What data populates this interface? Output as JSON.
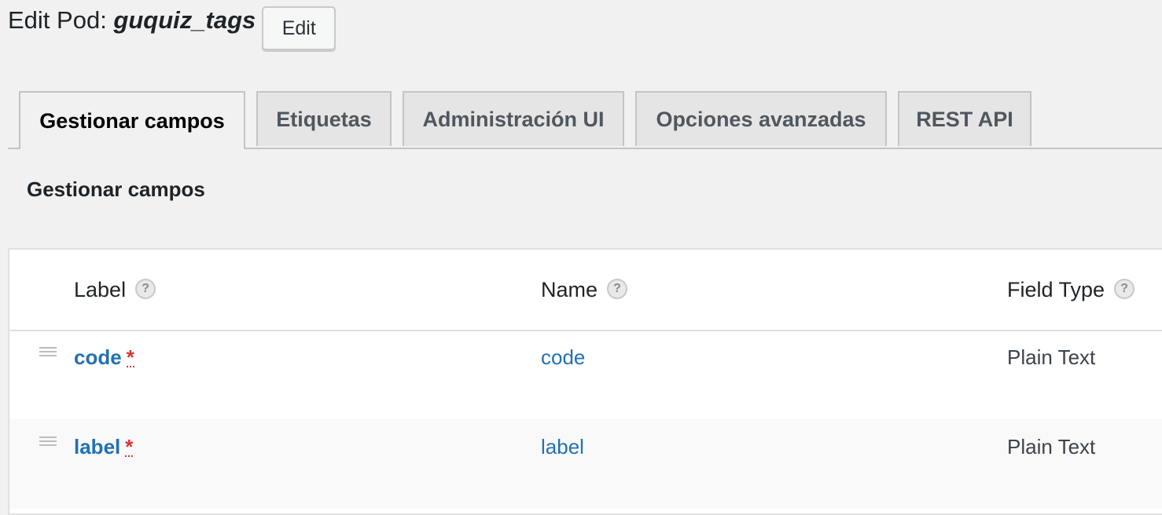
{
  "header": {
    "title_prefix": "Edit Pod: ",
    "pod_name": "guquiz_tags",
    "edit_label": "Edit"
  },
  "tabs": [
    {
      "label": "Gestionar campos",
      "active": true
    },
    {
      "label": "Etiquetas",
      "active": false
    },
    {
      "label": "Administración UI",
      "active": false
    },
    {
      "label": "Opciones avanzadas",
      "active": false
    },
    {
      "label": "REST API",
      "active": false
    }
  ],
  "section": {
    "title": "Gestionar campos"
  },
  "table": {
    "columns": [
      "Label",
      "Name",
      "Field Type"
    ],
    "help_glyph": "?",
    "required_glyph": "*",
    "rows": [
      {
        "label": "code",
        "name": "code",
        "type": "Plain Text",
        "required": true
      },
      {
        "label": "label",
        "name": "label",
        "type": "Plain Text",
        "required": true
      }
    ]
  },
  "colors": {
    "link": "#2271b1",
    "required": "#d63638"
  }
}
